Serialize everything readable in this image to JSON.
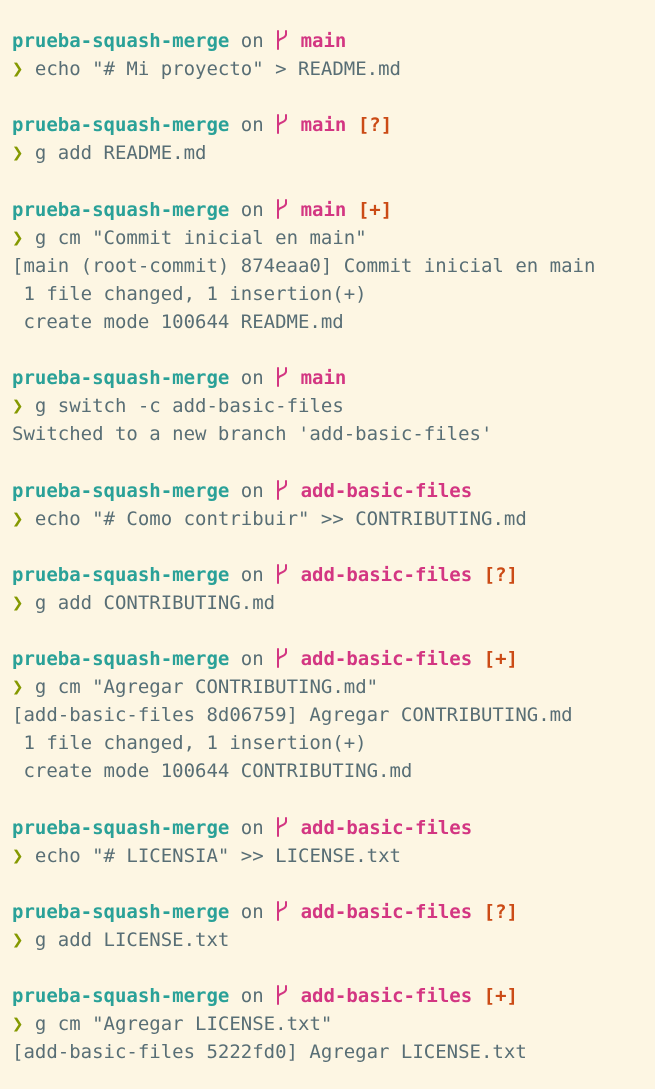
{
  "colors": {
    "background": "#fdf6e3",
    "directory": "#2aa198",
    "branch": "#d33682",
    "status": "#cb4b16",
    "prompt": "#859900",
    "text": "#586e75"
  },
  "terminal": {
    "blocks": [
      {
        "dir": "prueba-squash-merge",
        "on": "on",
        "branch_icon": "git-branch-icon",
        "branch": "main",
        "status": "",
        "prompt": "❯",
        "command": "echo \"# Mi proyecto\" > README.md",
        "output": []
      },
      {
        "dir": "prueba-squash-merge",
        "on": "on",
        "branch_icon": "git-branch-icon",
        "branch": "main",
        "status": "[?]",
        "prompt": "❯",
        "command": "g add README.md",
        "output": []
      },
      {
        "dir": "prueba-squash-merge",
        "on": "on",
        "branch_icon": "git-branch-icon",
        "branch": "main",
        "status": "[+]",
        "prompt": "❯",
        "command": "g cm \"Commit inicial en main\"",
        "output": [
          "[main (root-commit) 874eaa0] Commit inicial en main",
          " 1 file changed, 1 insertion(+)",
          " create mode 100644 README.md"
        ]
      },
      {
        "dir": "prueba-squash-merge",
        "on": "on",
        "branch_icon": "git-branch-icon",
        "branch": "main",
        "status": "",
        "prompt": "❯",
        "command": "g switch -c add-basic-files",
        "output": [
          "Switched to a new branch 'add-basic-files'"
        ]
      },
      {
        "dir": "prueba-squash-merge",
        "on": "on",
        "branch_icon": "git-branch-icon",
        "branch": "add-basic-files",
        "status": "",
        "prompt": "❯",
        "command": "echo \"# Como contribuir\" >> CONTRIBUTING.md",
        "output": []
      },
      {
        "dir": "prueba-squash-merge",
        "on": "on",
        "branch_icon": "git-branch-icon",
        "branch": "add-basic-files",
        "status": "[?]",
        "prompt": "❯",
        "command": "g add CONTRIBUTING.md",
        "output": []
      },
      {
        "dir": "prueba-squash-merge",
        "on": "on",
        "branch_icon": "git-branch-icon",
        "branch": "add-basic-files",
        "status": "[+]",
        "prompt": "❯",
        "command": "g cm \"Agregar CONTRIBUTING.md\"",
        "output": [
          "[add-basic-files 8d06759] Agregar CONTRIBUTING.md",
          " 1 file changed, 1 insertion(+)",
          " create mode 100644 CONTRIBUTING.md"
        ]
      },
      {
        "dir": "prueba-squash-merge",
        "on": "on",
        "branch_icon": "git-branch-icon",
        "branch": "add-basic-files",
        "status": "",
        "prompt": "❯",
        "command": "echo \"# LICENSIA\" >> LICENSE.txt",
        "output": []
      },
      {
        "dir": "prueba-squash-merge",
        "on": "on",
        "branch_icon": "git-branch-icon",
        "branch": "add-basic-files",
        "status": "[?]",
        "prompt": "❯",
        "command": "g add LICENSE.txt",
        "output": []
      },
      {
        "dir": "prueba-squash-merge",
        "on": "on",
        "branch_icon": "git-branch-icon",
        "branch": "add-basic-files",
        "status": "[+]",
        "prompt": "❯",
        "command": "g cm \"Agregar LICENSE.txt\"",
        "output": [
          "[add-basic-files 5222fd0] Agregar LICENSE.txt"
        ]
      }
    ]
  }
}
